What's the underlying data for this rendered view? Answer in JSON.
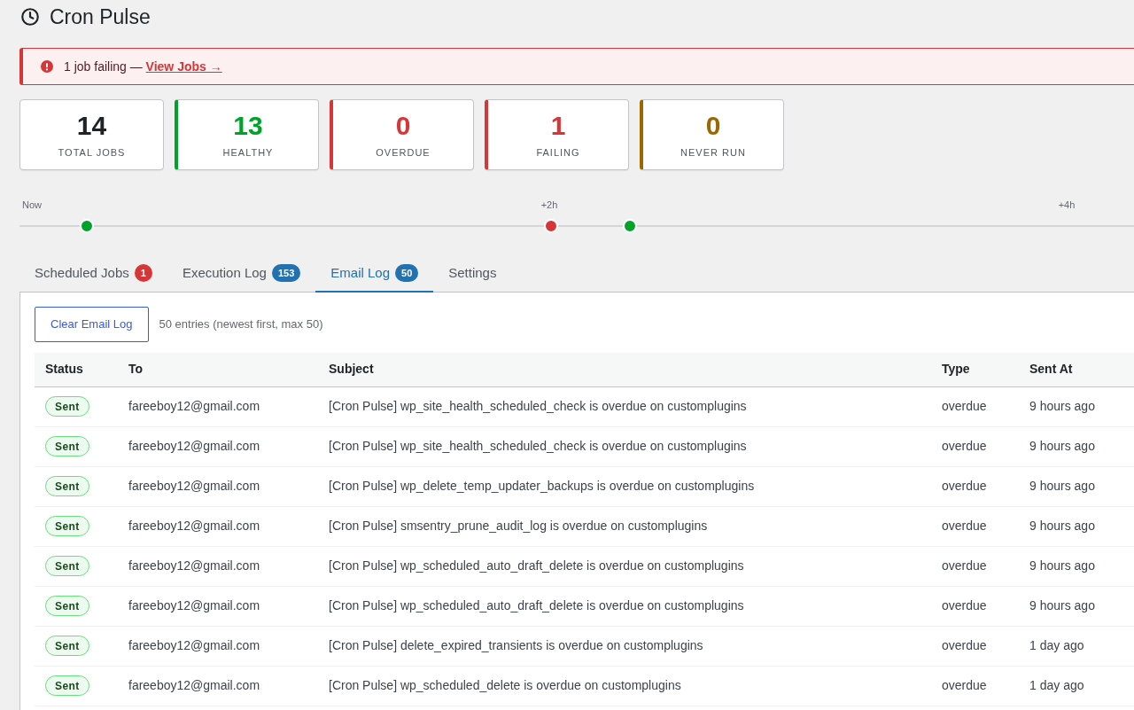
{
  "header": {
    "title": "Cron Pulse"
  },
  "notice": {
    "message": "1 job failing —",
    "link": "View Jobs →"
  },
  "stats": [
    {
      "value": "14",
      "label": "TOTAL JOBS",
      "color": "#1d2327",
      "accent": false
    },
    {
      "value": "13",
      "label": "HEALTHY",
      "color": "#00a32a",
      "accent": true
    },
    {
      "value": "0",
      "label": "OVERDUE",
      "color": "#d63638",
      "accent": true
    },
    {
      "value": "1",
      "label": "FAILING",
      "color": "#d63638",
      "accent": true
    },
    {
      "value": "0",
      "label": "NEVER RUN",
      "color": "#996800",
      "accent": true
    }
  ],
  "timeline": {
    "ticks": [
      "Now",
      "+2h",
      "+4h"
    ],
    "markers": [
      {
        "color": "#00a32a"
      },
      {
        "color": "#d63638"
      },
      {
        "color": "#00a32a"
      }
    ]
  },
  "tabs": [
    {
      "label": "Scheduled Jobs",
      "badge": {
        "text": "1",
        "color": "#d63638"
      },
      "selected": false
    },
    {
      "label": "Execution Log",
      "badge": {
        "text": "153",
        "color": "#2271b1"
      },
      "selected": false
    },
    {
      "label": "Email Log",
      "badge": {
        "text": "50",
        "color": "#2271b1"
      },
      "selected": true
    },
    {
      "label": "Settings",
      "selected": false
    }
  ],
  "email_log": {
    "clear_button": "Clear Email Log",
    "summary": "50 entries (newest first, max 50)",
    "table": {
      "columns": [
        "Status",
        "To",
        "Subject",
        "Type",
        "Sent At"
      ],
      "rows": [
        {
          "status": "Sent",
          "to": "fareeboy12@gmail.com",
          "subject": "[Cron Pulse] wp_site_health_scheduled_check is overdue on customplugins",
          "type": "overdue",
          "sent_at": "9 hours ago"
        },
        {
          "status": "Sent",
          "to": "fareeboy12@gmail.com",
          "subject": "[Cron Pulse] wp_site_health_scheduled_check is overdue on customplugins",
          "type": "overdue",
          "sent_at": "9 hours ago"
        },
        {
          "status": "Sent",
          "to": "fareeboy12@gmail.com",
          "subject": "[Cron Pulse] wp_delete_temp_updater_backups is overdue on customplugins",
          "type": "overdue",
          "sent_at": "9 hours ago"
        },
        {
          "status": "Sent",
          "to": "fareeboy12@gmail.com",
          "subject": "[Cron Pulse] smsentry_prune_audit_log is overdue on customplugins",
          "type": "overdue",
          "sent_at": "9 hours ago"
        },
        {
          "status": "Sent",
          "to": "fareeboy12@gmail.com",
          "subject": "[Cron Pulse] wp_scheduled_auto_draft_delete is overdue on customplugins",
          "type": "overdue",
          "sent_at": "9 hours ago"
        },
        {
          "status": "Sent",
          "to": "fareeboy12@gmail.com",
          "subject": "[Cron Pulse] wp_scheduled_auto_draft_delete is overdue on customplugins",
          "type": "overdue",
          "sent_at": "9 hours ago"
        },
        {
          "status": "Sent",
          "to": "fareeboy12@gmail.com",
          "subject": "[Cron Pulse] delete_expired_transients is overdue on customplugins",
          "type": "overdue",
          "sent_at": "1 day ago"
        },
        {
          "status": "Sent",
          "to": "fareeboy12@gmail.com",
          "subject": "[Cron Pulse] wp_scheduled_delete is overdue on customplugins",
          "type": "overdue",
          "sent_at": "1 day ago"
        }
      ]
    }
  }
}
